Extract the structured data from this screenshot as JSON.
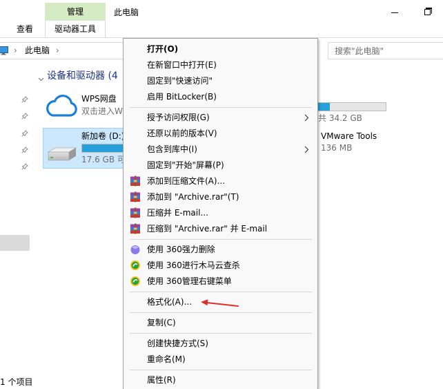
{
  "window": {
    "title": "此电脑",
    "minimize_icon": "minimize-icon",
    "restore_icon": "restore-icon"
  },
  "ribbon": {
    "tabs": [
      {
        "label": "查看"
      }
    ],
    "context_group_label": "管理",
    "context_tab_label": "驱动器工具",
    "context_group_color": "#d5ebc4"
  },
  "address_bar": {
    "location_icon": "this-pc-icon",
    "separator": "›",
    "path": [
      "此电脑"
    ],
    "search_placeholder": "搜索\"此电脑\""
  },
  "nav_pane": {
    "pinned_items": [
      {
        "icon": "pin-icon"
      },
      {
        "icon": "pin-icon"
      },
      {
        "icon": "pin-icon"
      },
      {
        "icon": "pin-icon"
      },
      {
        "icon": "pin-icon"
      }
    ]
  },
  "content": {
    "group_header": "设备和驱动器 (4",
    "group_expand_icon": "chevron-down-icon",
    "drives": [
      {
        "name": "WPS网盘",
        "detail": "双击进入W",
        "icon": "cloud-icon"
      },
      {
        "name": "新加卷 (D:)",
        "detail": "17.6 GB 可",
        "icon": "hard-drive-icon",
        "selected": true,
        "usage_fraction": 0.5
      }
    ],
    "drives_partial": [
      {
        "detail": "共 34.2 GB",
        "usage_fraction": 0.62
      },
      {
        "name": "VMware Tools",
        "detail": "136 MB"
      }
    ]
  },
  "context_menu": {
    "items": [
      {
        "label": "打开(O)",
        "default_action": true
      },
      {
        "label": "在新窗口中打开(E)"
      },
      {
        "label": "固定到\"快速访问\""
      },
      {
        "label": "启用 BitLocker(B)"
      },
      {
        "label": "授予访问权限(G)",
        "has_submenu": true,
        "submenu_icon": "chevron-right-icon"
      },
      {
        "label": "还原以前的版本(V)"
      },
      {
        "label": "包含到库中(I)",
        "has_submenu": true,
        "submenu_icon": "chevron-right-icon"
      },
      {
        "label": "固定到\"开始\"屏幕(P)"
      },
      {
        "label": "添加到压缩文件(A)...",
        "icon": "winrar-icon"
      },
      {
        "label": "添加到 \"Archive.rar\"(T)",
        "icon": "winrar-icon"
      },
      {
        "label": "压缩并 E-mail...",
        "icon": "winrar-icon"
      },
      {
        "label": "压缩到 \"Archive.rar\" 并 E-mail",
        "icon": "winrar-icon"
      },
      {
        "label": "使用 360强力删除",
        "icon": "360-shredder-icon"
      },
      {
        "label": "使用 360进行木马云查杀",
        "icon": "360-safe-icon"
      },
      {
        "label": "使用 360管理右键菜单",
        "icon": "360-safe-icon"
      },
      {
        "label": "格式化(A)..."
      },
      {
        "label": "复制(C)"
      },
      {
        "label": "创建快捷方式(S)"
      },
      {
        "label": "重命名(M)"
      },
      {
        "label": "属性(R)"
      }
    ]
  },
  "status_bar": {
    "item_count": "1 个项目"
  },
  "annotation": {
    "icon": "red-arrow-icon",
    "color": "#e02d2d"
  },
  "colors": {
    "selection": "#cce8ff",
    "selection_border": "#99d1ff",
    "usage_bar": "#26a0da",
    "group_header": "#1e3287"
  }
}
